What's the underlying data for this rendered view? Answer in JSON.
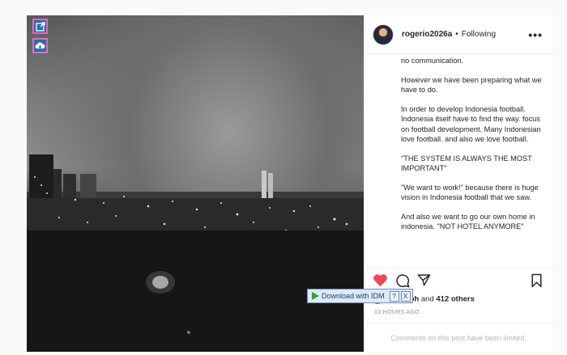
{
  "post": {
    "username": "rogerio2026a",
    "separator": "•",
    "follow_status": "Following",
    "caption_paragraphs": [
      "no communication.",
      "However we have been preparing what we have to do.",
      "In order to develop Indonesia football. Indonesia itself have to find the way. focus on football development. Many Indonesian love football. and also we love football.",
      "\"THE SYSTEM IS ALWAYS THE MOST IMPORTANT\"",
      "\"We want to work!\" because there is huge vision in Indonesia football that we saw.",
      "And also we want to go our own home in indonesia. \"NOT HOTEL ANYMORE\""
    ],
    "liked_by_user": "dusan.ph",
    "likes_connector": "and",
    "likes_others": "412 others",
    "timestamp": "10 HOURS AGO",
    "comments_notice": "Comments on this post have been limited."
  },
  "idm": {
    "label": "Download with IDM",
    "help": "?",
    "close": "X"
  },
  "colors": {
    "like_red": "#ed4956",
    "idm_blue": "#2b6ea8",
    "ext_border": "#e26bb8"
  },
  "icons": [
    "open-external-icon",
    "cloud-download-icon",
    "more-options-icon",
    "heart-icon",
    "comment-icon",
    "share-icon",
    "bookmark-icon",
    "play-icon"
  ]
}
